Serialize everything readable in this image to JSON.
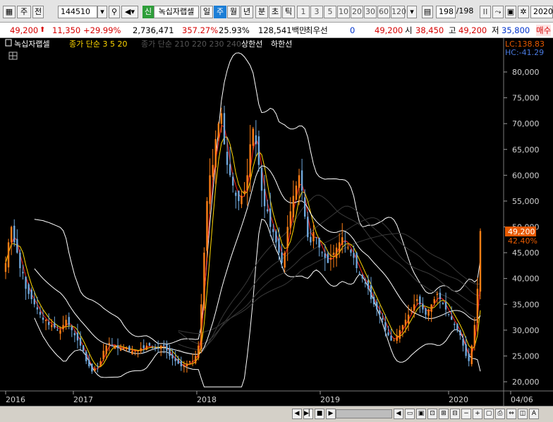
{
  "toolbar": {
    "market_label": "주",
    "prev_label": "전",
    "code": "144510",
    "issue_tag": "신",
    "stock_name": "녹십자랩셀",
    "periods": [
      "일",
      "주",
      "월",
      "년"
    ],
    "selected_period": "주",
    "intervals": [
      "분",
      "초",
      "틱"
    ],
    "interval_numbers": [
      "1",
      "3",
      "5",
      "10",
      "20",
      "30",
      "60",
      "120"
    ],
    "count": "198",
    "total": "/198",
    "year": "2020"
  },
  "quote": {
    "price": "49,200",
    "change": "11,350",
    "change_pct": "+29.99%",
    "volume": "2,736,471",
    "vol_ratio": "357.27%",
    "turnover": "25.93%",
    "amount": "128,541백만",
    "tag": "최우선",
    "best": "0",
    "price2": "49,200",
    "open_label": "시",
    "open": "38,450",
    "high_label": "고",
    "high": "49,200",
    "low_label": "저",
    "low": "35,800",
    "trail": "매수"
  },
  "legend": {
    "name": "녹십자랩셀",
    "ma": "종가 단순 3 5 20",
    "dim": "종가 단순 210 220 230 240",
    "upper": "상한선",
    "lower": "하한선"
  },
  "colors": {
    "bg": "#000000",
    "up": "#ff7f15",
    "down": "#6fa8dc",
    "ma3": "#ff2020",
    "ma5": "#ffd700",
    "ma20": "#ffffff",
    "band": "#ffffff",
    "price_tag": "#e85a00"
  },
  "chart_data": {
    "type": "candlestick",
    "y_ticks": [
      "80,000",
      "75,000",
      "70,000",
      "65,000",
      "60,000",
      "55,000",
      "50,000",
      "45,000",
      "40,000",
      "35,000",
      "30,000",
      "25,000",
      "20,000"
    ],
    "x_ticks": [
      "2016",
      "2017",
      "2018",
      "2019",
      "2020",
      "04/06"
    ],
    "ylim": [
      18000,
      84000
    ],
    "lc": "LC:138.83",
    "hc": "HC:-41.29",
    "last_price": "49,200",
    "last_pct": "42.40%",
    "weekly_close_approx": [
      43000,
      47000,
      50000,
      47000,
      45000,
      42000,
      41000,
      38000,
      37000,
      36000,
      35000,
      34000,
      33000,
      32000,
      32000,
      31000,
      31000,
      30500,
      30000,
      30000,
      31000,
      32000,
      31000,
      30000,
      29000,
      28000,
      27000,
      26000,
      24000,
      23000,
      22000,
      22500,
      23000,
      24000,
      26000,
      27000,
      27500,
      27000,
      27000,
      26500,
      26500,
      26500,
      26500,
      26000,
      26000,
      26000,
      26000,
      26500,
      26500,
      27000,
      27000,
      26500,
      26500,
      26500,
      27000,
      27000,
      26000,
      25000,
      24500,
      24000,
      23500,
      23000,
      23000,
      23500,
      24000,
      24000,
      25000,
      27000,
      35000,
      45000,
      55000,
      60000,
      62000,
      67000,
      70000,
      72000,
      66000,
      62000,
      60000,
      58000,
      56000,
      55000,
      56000,
      57000,
      60000,
      66000,
      69000,
      66000,
      62000,
      57000,
      54000,
      53000,
      50000,
      49000,
      47000,
      45000,
      43000,
      45000,
      50000,
      53000,
      56000,
      58000,
      60000,
      57000,
      52000,
      48000,
      47000,
      49000,
      48000,
      46000,
      45000,
      44000,
      43000,
      44000,
      45000,
      46000,
      47000,
      48000,
      47000,
      46000,
      45000,
      44000,
      42000,
      41000,
      40000,
      39000,
      38000,
      36000,
      35000,
      34000,
      33000,
      32000,
      30000,
      29000,
      28000,
      28000,
      29000,
      30000,
      31000,
      32000,
      33000,
      34000,
      35000,
      36000,
      35000,
      34000,
      33000,
      34000,
      35000,
      36000,
      37000,
      36000,
      35000,
      34000,
      33000,
      32000,
      31000,
      30000,
      29000,
      27000,
      25000,
      24000,
      27000,
      31000,
      38000,
      49200
    ]
  }
}
